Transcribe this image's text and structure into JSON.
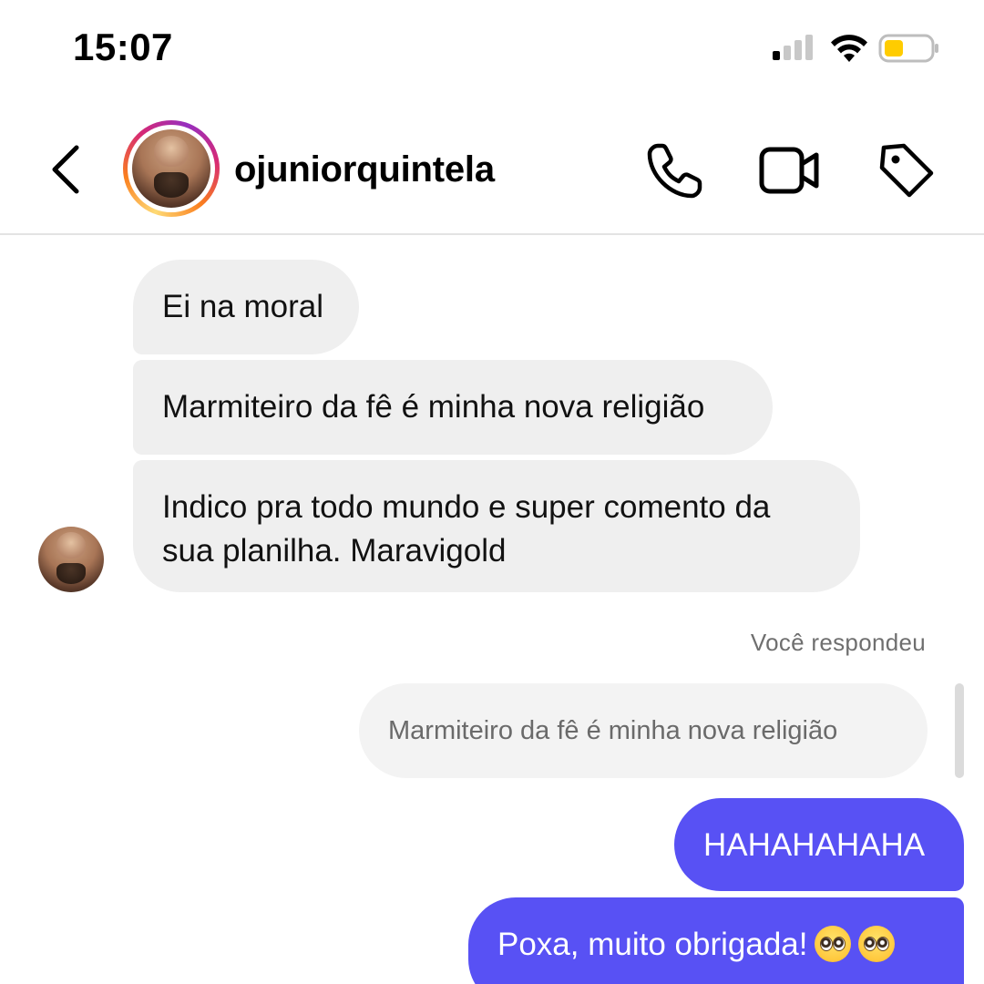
{
  "status_bar": {
    "time": "15:07",
    "signal_icon": "cellular-signal-icon",
    "wifi_icon": "wifi-icon",
    "battery_icon": "battery-low-icon",
    "battery_color": "#ffcc00"
  },
  "header": {
    "back_icon": "chevron-left-icon",
    "username": "ojuniorquintela",
    "story_ring_colors": [
      "#feda75",
      "#fa7e1e",
      "#d62976",
      "#962fbf"
    ],
    "actions": [
      "phone-icon",
      "video-camera-icon",
      "tag-icon"
    ]
  },
  "messages": {
    "incoming": [
      {
        "text": "Ei na moral"
      },
      {
        "text": "Marmiteiro da fê é minha nova religião"
      },
      {
        "line1": "Indico pra todo mundo e super comento da",
        "line2": "sua planilha. Maravigold"
      }
    ],
    "reply_note": "Você respondeu",
    "quoted_text": "Marmiteiro da fê é minha nova religião",
    "outgoing": [
      {
        "text": "HAHAHAHAHA"
      },
      {
        "text": "Poxa, muito obrigada!",
        "emojis": [
          "pleading-face-emoji",
          "pleading-face-emoji"
        ]
      }
    ],
    "incoming_bubble_color": "#efefef",
    "outgoing_bubble_color": "#5851f4"
  }
}
